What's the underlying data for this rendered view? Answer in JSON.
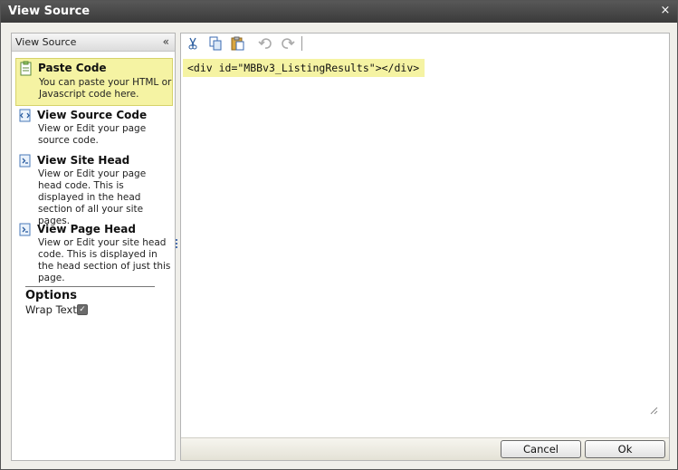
{
  "window": {
    "title": "View Source",
    "close_glyph": "×"
  },
  "sidebar": {
    "header": "View Source",
    "collapse_glyph": "«",
    "items": [
      {
        "title": "Paste Code",
        "description": "You can paste your HTML or Javascript code here.",
        "icon": "paste-code-icon",
        "selected": true
      },
      {
        "title": "View Source Code",
        "description": "View or Edit your page source code.",
        "icon": "source-code-icon",
        "selected": false
      },
      {
        "title": "View Site Head",
        "description": "View or Edit your page head code. This is displayed in the head section of all your site pages.",
        "icon": "site-head-icon",
        "selected": false
      },
      {
        "title": "View Page Head",
        "description": "View or Edit your site head code. This is displayed in the head section of just this page.",
        "icon": "page-head-icon",
        "selected": false
      }
    ],
    "options": {
      "title": "Options",
      "wrap_text_label": "Wrap Text",
      "wrap_text_checked": true
    }
  },
  "toolbar": {
    "buttons": [
      "cut-icon",
      "copy-icon",
      "paste-icon",
      "undo-icon",
      "redo-icon"
    ]
  },
  "editor": {
    "code": "<div id=\"MBBv3_ListingResults\"></div>"
  },
  "footer": {
    "cancel_label": "Cancel",
    "ok_label": "Ok"
  },
  "colors": {
    "titlebar": "#3a3a3a",
    "highlight": "#f5f3a3",
    "panel_bg": "#f0efea"
  }
}
